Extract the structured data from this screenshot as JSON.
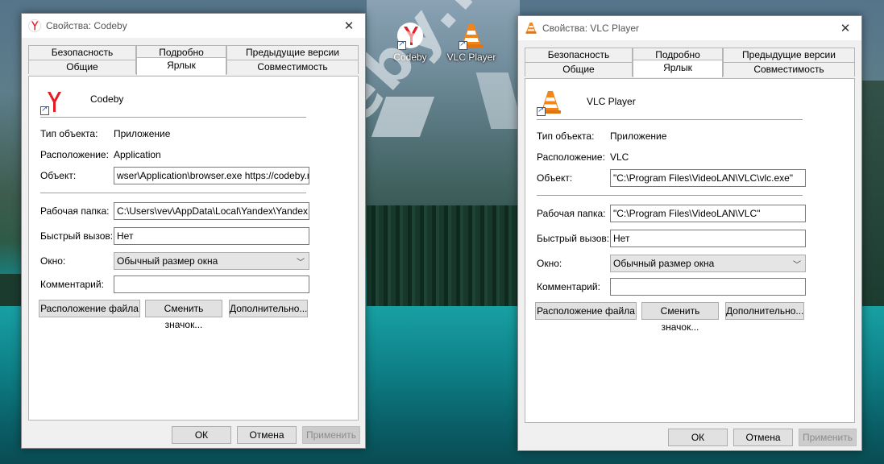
{
  "watermark": "codeby.net",
  "desktop_icons": [
    {
      "label": "Codeby",
      "icon": "yandex-browser-icon"
    },
    {
      "label": "VLC Player",
      "icon": "vlc-cone-icon"
    }
  ],
  "tabs_top": [
    "Безопасность",
    "Подробно",
    "Предыдущие версии"
  ],
  "tabs_bottom": [
    "Общие",
    "Ярлык",
    "Совместимость"
  ],
  "labels": {
    "type": "Тип объекта:",
    "location": "Расположение:",
    "target": "Объект:",
    "workdir": "Рабочая папка:",
    "hotkey": "Быстрый вызов:",
    "window": "Окно:",
    "comment": "Комментарий:"
  },
  "buttons": {
    "open_location": "Расположение файла",
    "change_icon": "Сменить значок...",
    "advanced": "Дополнительно...",
    "ok": "ОК",
    "cancel": "Отмена",
    "apply": "Применить"
  },
  "windows": [
    {
      "title": "Свойства: Codeby",
      "name": "Codeby",
      "type": "Приложение",
      "location": "Application",
      "target": "wser\\Application\\browser.exe https://codeby.net/",
      "workdir": "C:\\Users\\vev\\AppData\\Local\\Yandex\\YandexBro",
      "hotkey": "Нет",
      "window_mode": "Обычный размер окна",
      "comment": ""
    },
    {
      "title": "Свойства: VLC Player",
      "name": "VLC Player",
      "type": "Приложение",
      "location": "VLC",
      "target": "\"C:\\Program Files\\VideoLAN\\VLC\\vlc.exe\"",
      "workdir": "\"C:\\Program Files\\VideoLAN\\VLC\"",
      "hotkey": "Нет",
      "window_mode": "Обычный размер окна",
      "comment": ""
    }
  ],
  "colors": {
    "yandex_red": "#e21c23",
    "vlc_orange": "#f08519",
    "window_bg": "#f0f0f0",
    "disabled_text": "#8c8c8c"
  }
}
